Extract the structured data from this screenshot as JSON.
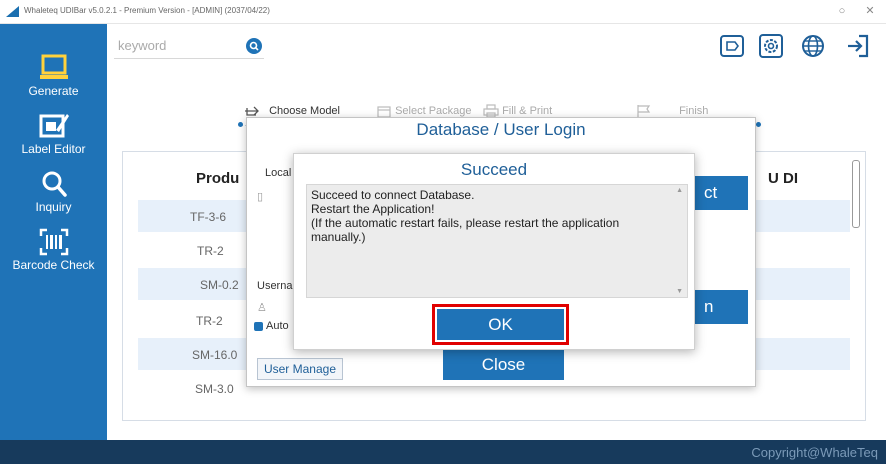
{
  "window": {
    "title": "Whaleteq UDIBar v5.0.2.1 - Premium Version - [ADMIN] (2037/04/22)",
    "minimize_glyph": "○",
    "close_glyph": "✕"
  },
  "sidebar": {
    "items": [
      {
        "label": "Generate",
        "icon": "laptop-icon"
      },
      {
        "label": "Label Editor",
        "icon": "edit-label-icon"
      },
      {
        "label": "Inquiry",
        "icon": "search-icon"
      },
      {
        "label": "Barcode Check",
        "icon": "barcode-icon"
      }
    ]
  },
  "search": {
    "placeholder": "keyword",
    "value": ""
  },
  "toolbar": {
    "icons": [
      "tag-icon",
      "gear-icon",
      "globe-icon",
      "logout-icon"
    ]
  },
  "stepper": {
    "steps": [
      {
        "label": "Choose Model",
        "icon": "hand-pointer-icon",
        "active": true
      },
      {
        "label": "Select Package",
        "icon": "package-icon",
        "active": false
      },
      {
        "label": "Fill & Print",
        "icon": "printer-icon",
        "active": false
      },
      {
        "label": "Finish",
        "icon": "flag-icon",
        "active": false
      }
    ]
  },
  "table": {
    "headers": [
      "Produ",
      "U DI"
    ],
    "rows": [
      "TF-3-6",
      "TR-2",
      "SM-0.2",
      "TR-2",
      "SM-16.0",
      "SM-3.0"
    ]
  },
  "login_dialog": {
    "title": "Database / User Login",
    "local_db_label": "Local D",
    "username_label": "Usernar",
    "auto_label": "Auto",
    "connect_fragment": "ct",
    "login_fragment": "n",
    "user_manage_label": "User Manage",
    "close_label": "Close"
  },
  "succeed_dialog": {
    "title": "Succeed",
    "message": "Succeed to connect Database.\nRestart the Application!\n(If the automatic restart fails, please restart the application manually.)",
    "ok_label": "OK"
  },
  "footer": {
    "copyright": "Copyright@WhaleTeq"
  },
  "colors": {
    "accent": "#1f73b7",
    "footer": "#173a5c",
    "highlight": "#e00000"
  }
}
